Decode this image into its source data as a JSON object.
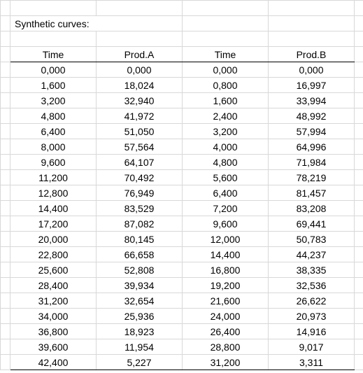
{
  "title": "Synthetic curves:",
  "headers": {
    "timeA": "Time",
    "prodA": "Prod.A",
    "timeB": "Time",
    "prodB": "Prod.B"
  },
  "rows": [
    {
      "tA": "0,000",
      "pA": "0,000",
      "tB": "0,000",
      "pB": "0,000"
    },
    {
      "tA": "1,600",
      "pA": "18,024",
      "tB": "0,800",
      "pB": "16,997"
    },
    {
      "tA": "3,200",
      "pA": "32,940",
      "tB": "1,600",
      "pB": "33,994"
    },
    {
      "tA": "4,800",
      "pA": "41,972",
      "tB": "2,400",
      "pB": "48,992"
    },
    {
      "tA": "6,400",
      "pA": "51,050",
      "tB": "3,200",
      "pB": "57,994"
    },
    {
      "tA": "8,000",
      "pA": "57,564",
      "tB": "4,000",
      "pB": "64,996"
    },
    {
      "tA": "9,600",
      "pA": "64,107",
      "tB": "4,800",
      "pB": "71,984"
    },
    {
      "tA": "11,200",
      "pA": "70,492",
      "tB": "5,600",
      "pB": "78,219"
    },
    {
      "tA": "12,800",
      "pA": "76,949",
      "tB": "6,400",
      "pB": "81,457"
    },
    {
      "tA": "14,400",
      "pA": "83,529",
      "tB": "7,200",
      "pB": "83,208"
    },
    {
      "tA": "17,200",
      "pA": "87,082",
      "tB": "9,600",
      "pB": "69,441"
    },
    {
      "tA": "20,000",
      "pA": "80,145",
      "tB": "12,000",
      "pB": "50,783"
    },
    {
      "tA": "22,800",
      "pA": "66,658",
      "tB": "14,400",
      "pB": "44,237"
    },
    {
      "tA": "25,600",
      "pA": "52,808",
      "tB": "16,800",
      "pB": "38,335"
    },
    {
      "tA": "28,400",
      "pA": "39,934",
      "tB": "19,200",
      "pB": "32,536"
    },
    {
      "tA": "31,200",
      "pA": "32,654",
      "tB": "21,600",
      "pB": "26,622"
    },
    {
      "tA": "34,000",
      "pA": "25,936",
      "tB": "24,000",
      "pB": "20,973"
    },
    {
      "tA": "36,800",
      "pA": "18,923",
      "tB": "26,400",
      "pB": "14,916"
    },
    {
      "tA": "39,600",
      "pA": "11,954",
      "tB": "28,800",
      "pB": "9,017"
    },
    {
      "tA": "42,400",
      "pA": "5,227",
      "tB": "31,200",
      "pB": "3,311"
    }
  ]
}
